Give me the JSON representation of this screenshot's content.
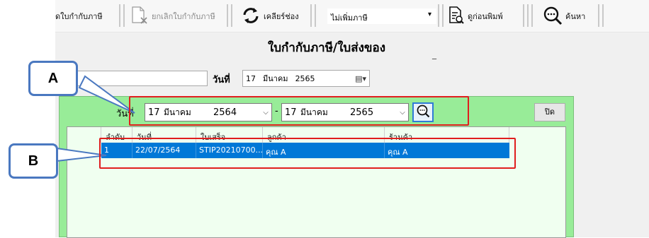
{
  "toolbar": {
    "partial_label": "ดใบกำกับภาษี",
    "cancel_invoice_label": "ยกเลิกใบกำกับภาษี",
    "clear_label": "เคลียร์ช่อง",
    "tax_option_value": "ไม่เพิ่มภาษี",
    "print_preview_label": "ดูก่อนพิมพ์",
    "search_label": "ค้นหา"
  },
  "form": {
    "title": "ใบกำกับภาษี/ใบส่งของ",
    "title_marker": "_",
    "date_label": "วันที่",
    "date": {
      "day": "17",
      "month": "มีนาคม",
      "year": "2565"
    }
  },
  "dialog": {
    "date_label": "วันที่",
    "from_date": {
      "day": "17",
      "month": "มีนาคม",
      "year": "2564"
    },
    "range_separator": "-",
    "to_date": {
      "day": "17",
      "month": "มีนาคม",
      "year": "2565"
    },
    "close_label": "ปิด",
    "grid": {
      "columns": [
        "ลำดับ",
        "วันที่",
        "ใบเสร็จ",
        "ลูกค้า",
        "ร้านค้า"
      ],
      "rows": [
        {
          "index": "1",
          "date": "22/07/2564",
          "receipt": "STIP20210700...",
          "customer": "คุณ A",
          "store": "คุณ A"
        }
      ]
    }
  },
  "annotations": {
    "a_label": "A",
    "b_label": "B"
  },
  "colors": {
    "dialog_bg": "#98ec98",
    "selected_row": "#0078d7",
    "annotation_red": "#e01e1e",
    "callout_border": "#4a78c0"
  }
}
